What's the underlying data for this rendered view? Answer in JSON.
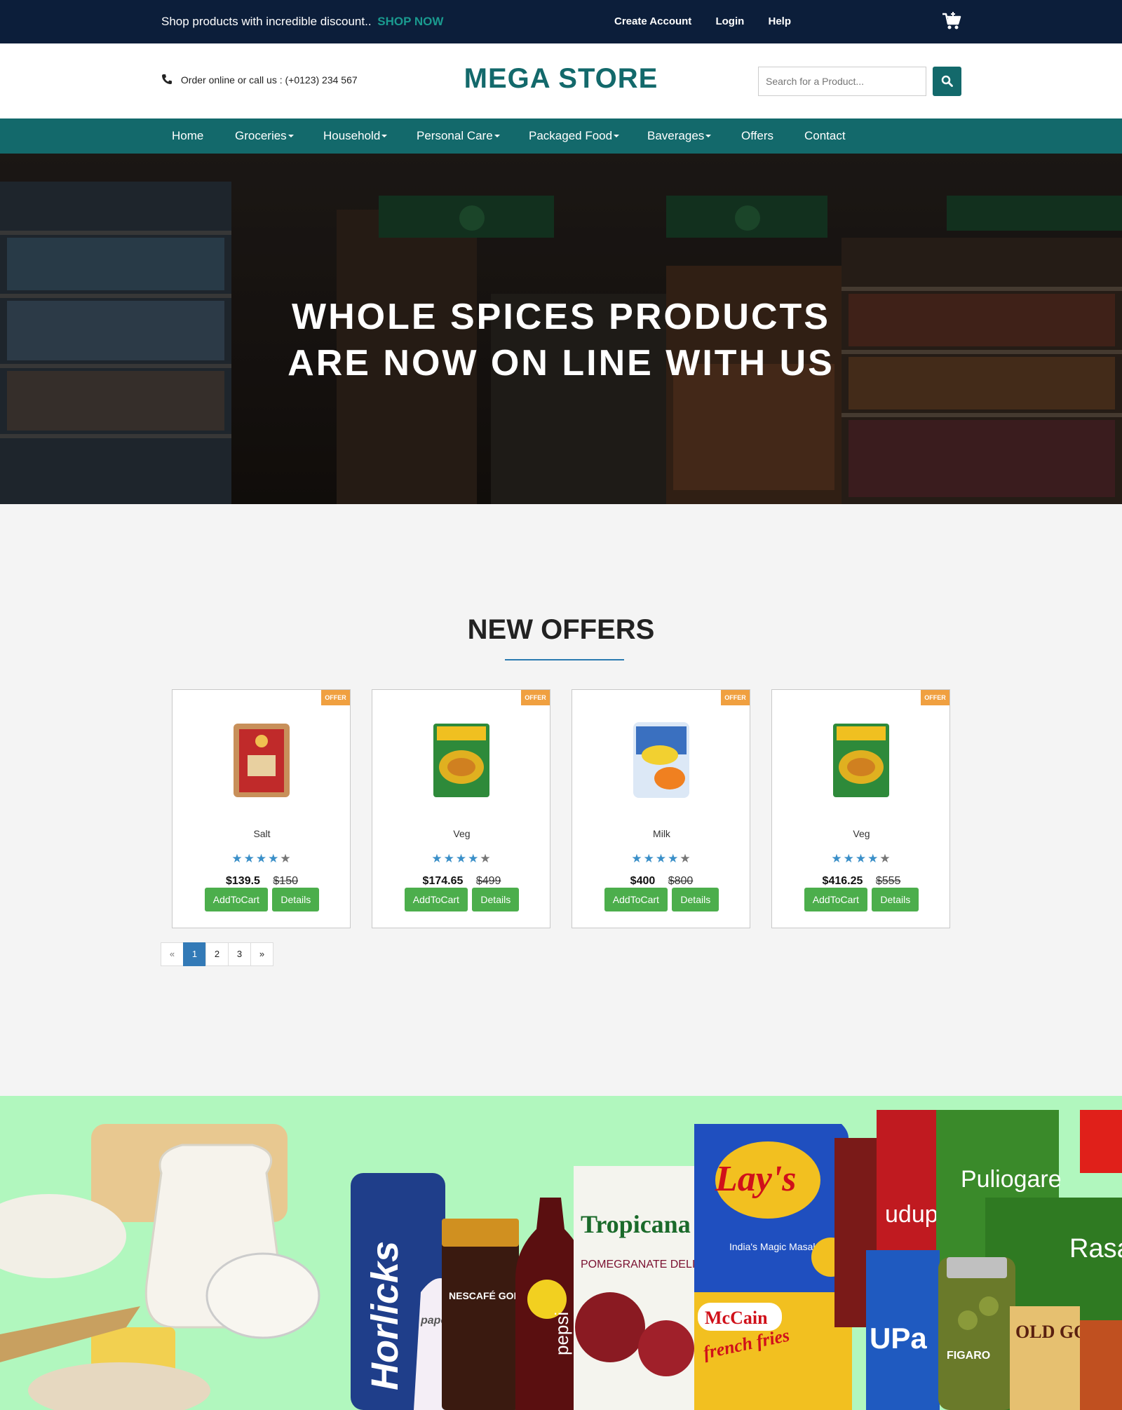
{
  "topbar": {
    "promo_text": "Shop products with incredible discount..",
    "shop_now": "SHOP NOW",
    "links": [
      "Create Account",
      "Login",
      "Help"
    ]
  },
  "header": {
    "phone_text": "Order online or call us : (+0123) 234 567",
    "logo": "MEGA STORE",
    "search_placeholder": "Search for a Product..."
  },
  "nav": {
    "items": [
      "Home",
      "Groceries",
      "Household",
      "Personal Care",
      "Packaged Food",
      "Baverages",
      "Offers",
      "Contact"
    ]
  },
  "hero": {
    "line1": "WHOLE SPICES PRODUCTS",
    "line2": "ARE NOW ON LINE WITH US"
  },
  "offers": {
    "title": "NEW OFFERS",
    "badge": "OFFER",
    "add_label": "AddToCart",
    "details_label": "Details",
    "products": [
      {
        "name": "Salt",
        "price": "$139.5",
        "old_price": "$150",
        "rating": 4
      },
      {
        "name": "Veg",
        "price": "$174.65",
        "old_price": "$499",
        "rating": 4
      },
      {
        "name": "Milk",
        "price": "$400",
        "old_price": "$800",
        "rating": 4
      },
      {
        "name": "Veg",
        "price": "$416.25",
        "old_price": "$555",
        "rating": 4
      }
    ]
  },
  "pagination": {
    "prev": "«",
    "pages": [
      "1",
      "2",
      "3"
    ],
    "next": "»",
    "current": "1"
  },
  "banner": {
    "brand_texts": [
      "Horlicks",
      "NESCAFÉ GOLD",
      "pepsi",
      "Tropicana",
      "POMEGRANATE DELIGHT",
      "Lay's",
      "India's Magic Masala",
      "McCain",
      "french fries",
      "udupi ruchi",
      "Puliogare",
      "Rasam",
      "OLD GOLD",
      "FIGARO",
      "paper boat"
    ]
  },
  "colors": {
    "topbar": "#0c1e3a",
    "brand": "#13696b",
    "accent": "#1a9a8f",
    "offer_badge": "#f0a040",
    "button_green": "#4cae4c",
    "star": "#3a8fc8",
    "banner_bg": "#b1f7be"
  }
}
